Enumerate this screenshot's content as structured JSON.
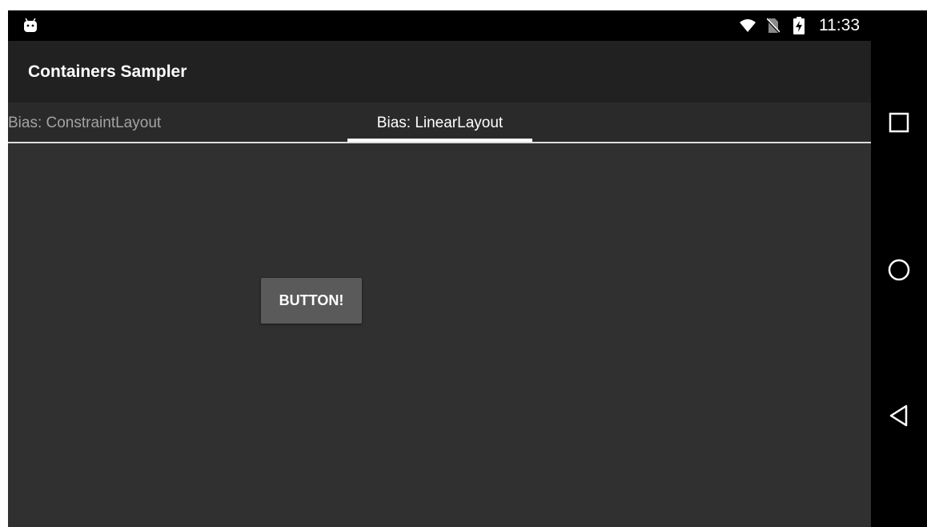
{
  "status_bar": {
    "time": "11:33",
    "icons": [
      "android-notification-icon",
      "wifi-icon",
      "no-sim-icon",
      "battery-charging-icon"
    ]
  },
  "app_bar": {
    "title": "Containers Sampler"
  },
  "tabs": [
    {
      "label": "Bias: ConstraintLayout",
      "selected": false
    },
    {
      "label": "Bias: LinearLayout",
      "selected": true
    }
  ],
  "content": {
    "button_label": "BUTTON!"
  },
  "nav_bar": {
    "buttons": [
      "recents-icon",
      "home-icon",
      "back-icon"
    ]
  },
  "colors": {
    "status_bar": "#000000",
    "app_bar": "#212121",
    "tab_bar": "#2a2a2a",
    "content": "#303030",
    "button": "#5a5a5a"
  }
}
